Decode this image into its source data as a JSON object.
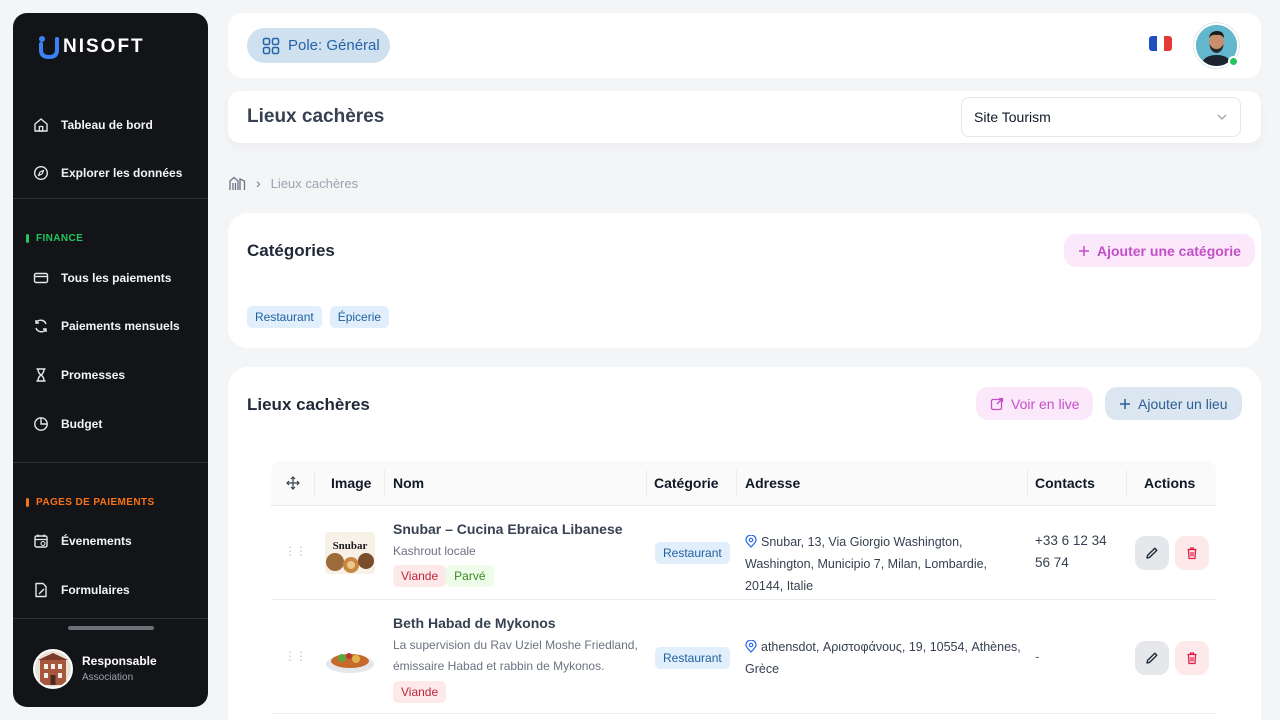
{
  "brand": {
    "name": "NISOFT"
  },
  "sidebar": {
    "main_items": [
      {
        "label": "Tableau de bord",
        "icon": "home-icon"
      },
      {
        "label": "Explorer les données",
        "icon": "compass-icon"
      }
    ],
    "finance": {
      "title": "FINANCE",
      "color": "#22c55e",
      "items": [
        {
          "label": "Tous les paiements",
          "icon": "credit-card-icon"
        },
        {
          "label": "Paiements mensuels",
          "icon": "refresh-icon"
        },
        {
          "label": "Promesses",
          "icon": "hourglass-icon"
        },
        {
          "label": "Budget",
          "icon": "pie-chart-icon"
        }
      ]
    },
    "payment_pages": {
      "title": "PAGES DE PAIEMENTS",
      "color": "#f97316",
      "items": [
        {
          "label": "Évenements",
          "icon": "calendar-icon"
        },
        {
          "label": "Formulaires",
          "icon": "form-icon"
        }
      ]
    },
    "profile": {
      "name": "Responsable",
      "role": "Association"
    }
  },
  "topbar": {
    "pole_label": "Pole: Général"
  },
  "page": {
    "title": "Lieux cachères",
    "site_select": {
      "value": "Site Tourism"
    }
  },
  "breadcrumb": {
    "current": "Lieux cachères"
  },
  "categories": {
    "title": "Catégories",
    "add_label": "Ajouter une catégorie",
    "items": [
      "Restaurant",
      "Épicerie"
    ]
  },
  "places": {
    "title": "Lieux cachères",
    "live_label": "Voir en live",
    "add_label": "Ajouter un lieu",
    "columns": [
      "Image",
      "Nom",
      "Catégorie",
      "Adresse",
      "Contacts",
      "Actions"
    ],
    "rows": [
      {
        "name": "Snubar – Cucina Ebraica Libanese",
        "description": "Kashrout locale",
        "tags": [
          {
            "label": "Viande",
            "kind": "red"
          },
          {
            "label": "Parvé",
            "kind": "green"
          }
        ],
        "category": "Restaurant",
        "address": "Snubar, 13, Via Giorgio Washington, Washington, Municipio 7, Milan, Lombardie, 20144, Italie",
        "contact": "+33 6 12 34 56 74"
      },
      {
        "name": "Beth Habad de Mykonos",
        "description": "La supervision du Rav Uziel Moshe Friedland, émissaire Habad et rabbin de Mykonos.",
        "tags": [
          {
            "label": "Viande",
            "kind": "red"
          }
        ],
        "category": "Restaurant",
        "address": "athensdot, Αριστοφάνους, 19, 10554, Athènes, Grèce",
        "contact": "-"
      }
    ]
  }
}
